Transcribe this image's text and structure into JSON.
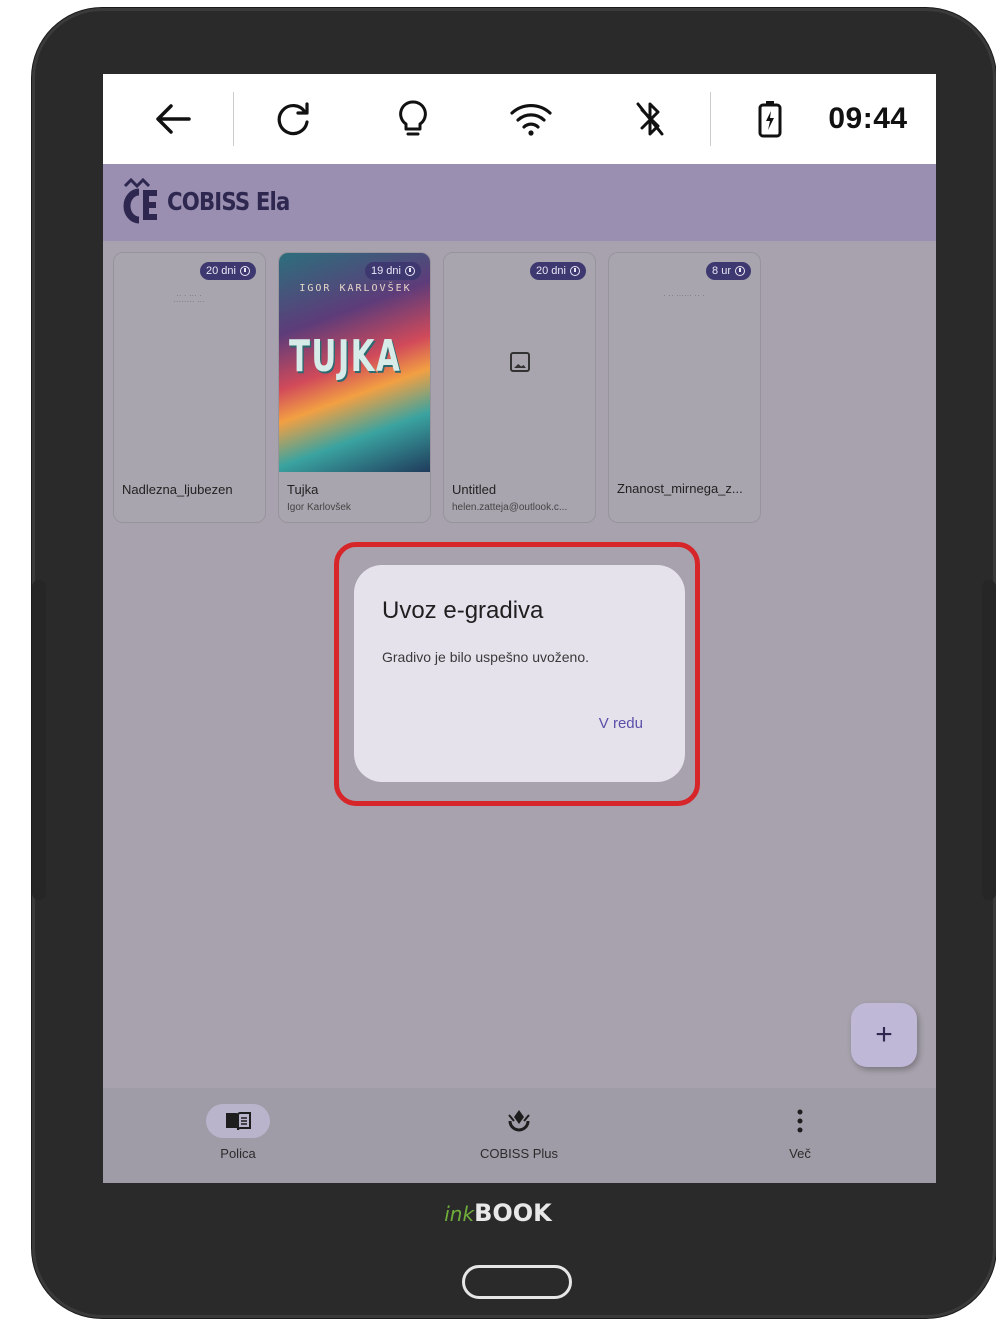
{
  "status_bar": {
    "time": "09:44"
  },
  "app": {
    "logo_text": "COBISS Ela"
  },
  "shelf": {
    "items": [
      {
        "title": "Nadlezna_ljubezen",
        "subtitle": "",
        "badge": "20 dni",
        "cover": "text"
      },
      {
        "title": "Tujka",
        "subtitle": "Igor Karlovšek",
        "badge": "19 dni",
        "cover": "image",
        "cover_title": "TUJKA",
        "cover_author": "IGOR KARLOVŠEK"
      },
      {
        "title": "Untitled",
        "subtitle": "helen.zatteja@outlook.c...",
        "badge": "20 dni",
        "cover": "placeholder"
      },
      {
        "title": "Znanost_mirnega_z...",
        "subtitle": "",
        "badge": "8 ur",
        "cover": "text"
      }
    ]
  },
  "dialog": {
    "title": "Uvoz e-gradiva",
    "message": "Gradivo je bilo uspešno uvoženo.",
    "ok_label": "V redu"
  },
  "fab": {
    "label": "+"
  },
  "bottom_nav": {
    "items": [
      {
        "label": "Polica",
        "icon": "book-icon",
        "active": true
      },
      {
        "label": "COBISS Plus",
        "icon": "cobiss-plus-icon",
        "active": false
      },
      {
        "label": "Več",
        "icon": "more-vert-icon",
        "active": false
      }
    ]
  },
  "device": {
    "brand_ink": "ink",
    "brand_book": "BOOK"
  },
  "colors": {
    "accent": "#5a4fa8",
    "badge_bg": "#3d3870",
    "highlight": "#d7262a"
  }
}
